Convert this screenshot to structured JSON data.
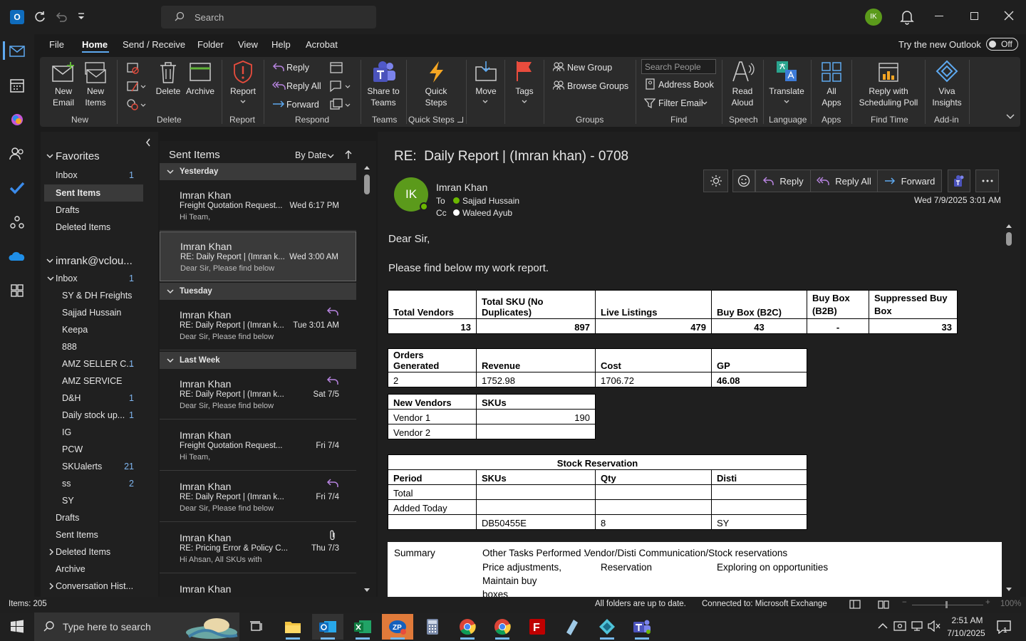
{
  "titlebar": {
    "search_placeholder": "Search",
    "avatar_initials": "IK"
  },
  "menu": {
    "tabs": [
      "File",
      "Home",
      "Send / Receive",
      "Folder",
      "View",
      "Help",
      "Acrobat"
    ],
    "active": "Home",
    "try_new": "Try the new Outlook",
    "toggle": "Off"
  },
  "ribbon": {
    "new_email": "New\nEmail",
    "new_items": "New\nItems",
    "delete": "Delete",
    "archive": "Archive",
    "report": "Report",
    "reply": "Reply",
    "reply_all": "Reply All",
    "forward": "Forward",
    "share_teams": "Share to\nTeams",
    "quick_steps": "Quick\nSteps",
    "move": "Move",
    "tags": "Tags",
    "new_group": "New Group",
    "browse_groups": "Browse Groups",
    "search_people": "Search People",
    "address_book": "Address Book",
    "filter_email": "Filter Email",
    "read_aloud": "Read\nAloud",
    "translate": "Translate",
    "all_apps": "All\nApps",
    "reply_poll": "Reply with\nScheduling Poll",
    "viva": "Viva\nInsights",
    "groups": [
      "New",
      "Delete",
      "Report",
      "Respond",
      "Teams",
      "Quick Steps",
      "Groups",
      "Find",
      "Speech",
      "Language",
      "Apps",
      "Find Time",
      "Add-in"
    ]
  },
  "nav": {
    "favorites": "Favorites",
    "fav_items": [
      {
        "label": "Inbox",
        "count": "1"
      },
      {
        "label": "Sent Items",
        "count": ""
      },
      {
        "label": "Drafts",
        "count": ""
      },
      {
        "label": "Deleted Items",
        "count": ""
      }
    ],
    "account": "imrank@vclou...",
    "inbox": {
      "label": "Inbox",
      "count": "1"
    },
    "subfolders": [
      {
        "label": "SY & DH Freights",
        "count": ""
      },
      {
        "label": "Sajjad Hussain",
        "count": ""
      },
      {
        "label": "Keepa",
        "count": ""
      },
      {
        "label": "888",
        "count": ""
      },
      {
        "label": "AMZ SELLER C...",
        "count": "1"
      },
      {
        "label": "AMZ SERVICE",
        "count": ""
      },
      {
        "label": "D&H",
        "count": "1"
      },
      {
        "label": "Daily stock up...",
        "count": "1"
      },
      {
        "label": "IG",
        "count": ""
      },
      {
        "label": "PCW",
        "count": ""
      },
      {
        "label": "SKUalerts",
        "count": "21"
      },
      {
        "label": "ss",
        "count": "2"
      },
      {
        "label": "SY",
        "count": ""
      }
    ],
    "other": [
      "Drafts",
      "Sent Items",
      "Deleted Items",
      "Archive",
      "Conversation Hist..."
    ]
  },
  "list": {
    "title": "Sent Items",
    "sort": "By Date",
    "groups": [
      "Yesterday",
      "Tuesday",
      "Last Week"
    ],
    "messages": [
      {
        "from": "Imran Khan",
        "subject": "Freight Quotation Request...",
        "date": "Wed 6:17 PM",
        "preview": "Hi Team,"
      },
      {
        "from": "Imran Khan",
        "subject": "RE: Daily Report | (Imran k...",
        "date": "Wed 3:00 AM",
        "preview": "Dear Sir,  Please find below"
      },
      {
        "from": "Imran Khan",
        "subject": "RE: Daily Report | (Imran k...",
        "date": "Tue 3:01 AM",
        "preview": "Dear Sir,  Please find below"
      },
      {
        "from": "Imran Khan",
        "subject": "RE: Daily Report | (Imran k...",
        "date": "Sat 7/5",
        "preview": "Dear Sir,  Please find below"
      },
      {
        "from": "Imran Khan",
        "subject": "Freight Quotation Request...",
        "date": "Fri 7/4",
        "preview": "Hi Team,"
      },
      {
        "from": "Imran Khan",
        "subject": "RE: Daily Report | (Imran k...",
        "date": "Fri 7/4",
        "preview": "Dear Sir,  Please find below"
      },
      {
        "from": "Imran Khan",
        "subject": "RE: Pricing Error & Policy C...",
        "date": "Thu 7/3",
        "preview": "Hi Ahsan,  All SKUs with"
      },
      {
        "from": "Imran Khan",
        "subject": "",
        "date": "",
        "preview": ""
      }
    ]
  },
  "reading": {
    "subject": "RE:  Daily Report | (Imran khan) - 0708",
    "avatar": "IK",
    "sender": "Imran Khan",
    "to_label": "To",
    "to": "Sajjad Hussain",
    "cc_label": "Cc",
    "cc": "Waleed Ayub",
    "date": "Wed 7/9/2025 3:01 AM",
    "actions": {
      "reply": "Reply",
      "reply_all": "Reply All",
      "forward": "Forward"
    },
    "greeting": "Dear Sir,",
    "intro": "Please find below my work report.",
    "t1": {
      "headers": [
        "Total Vendors",
        "Total SKU (No Duplicates)",
        "Live Listings",
        "Buy Box (B2C)",
        "Buy Box (B2B)",
        "Suppressed Buy Box"
      ],
      "values": [
        "13",
        "897",
        "479",
        "43",
        "-",
        "33"
      ]
    },
    "t2": {
      "headers": [
        "Orders Generated",
        "Revenue",
        "Cost",
        "GP"
      ],
      "values": [
        "2",
        "1752.98",
        "1706.72",
        "46.08"
      ]
    },
    "t3": {
      "headers": [
        "New Vendors",
        "SKUs"
      ],
      "rows": [
        [
          "Vendor 1",
          "190"
        ],
        [
          "Vendor 2",
          ""
        ]
      ]
    },
    "t4": {
      "title": "Stock Reservation",
      "headers": [
        "Period",
        "SKUs",
        "Qty",
        "Disti"
      ],
      "rows": [
        [
          "Total",
          "",
          "",
          ""
        ],
        [
          "Added Today",
          "",
          "",
          ""
        ],
        [
          "",
          "DB50455E",
          "8",
          "SY"
        ]
      ]
    },
    "summary": {
      "label": "Summary",
      "other_label": "Other Tasks Performed :",
      "other_value": "Vendor/Disti Communication/Stock reservations",
      "col1": "Price adjustments,",
      "col1b": "Maintain buy",
      "col1c": "boxes",
      "col2": "Reservation",
      "col3": "Exploring on opportunities"
    }
  },
  "status": {
    "items": "Items: 205",
    "sync": "All folders are up to date.",
    "conn": "Connected to: Microsoft Exchange",
    "zoom": "100%"
  },
  "taskbar": {
    "search": "Type here to search",
    "time": "2:51 AM",
    "date": "7/10/2025",
    "notif": "1"
  },
  "colors": {
    "accent": "#0f6cbd",
    "avatar_green": "#5b9a1b",
    "list_selected": "#3a3a3a"
  }
}
